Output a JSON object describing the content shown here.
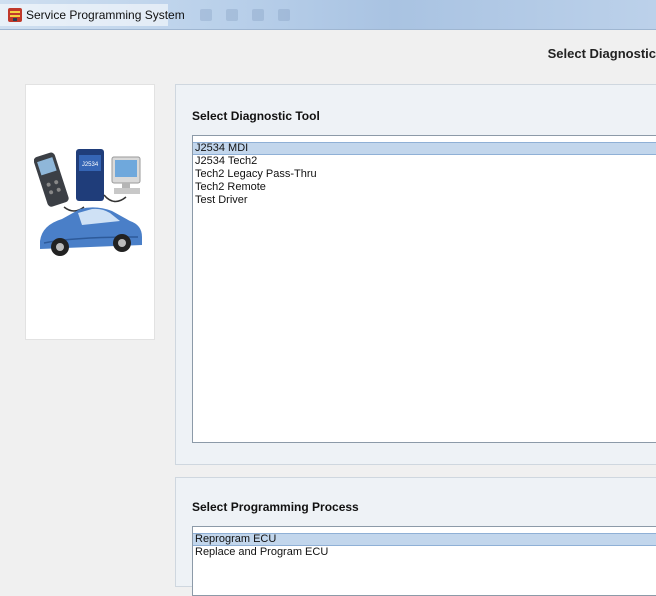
{
  "window": {
    "title": "Service Programming System"
  },
  "page": {
    "heading": "Select Diagnostic"
  },
  "illustration": {
    "label": "J2534"
  },
  "diagnostic_tool": {
    "title": "Select Diagnostic Tool",
    "items": [
      "J2534 MDI",
      "J2534 Tech2",
      "Tech2 Legacy Pass-Thru",
      "Tech2 Remote",
      "Test Driver"
    ],
    "selected": "J2534 MDI"
  },
  "programming_process": {
    "title": "Select Programming Process",
    "items": [
      "Reprogram ECU",
      "Replace and Program ECU"
    ],
    "selected": "Reprogram ECU"
  },
  "colors": {
    "selection": "#c2d6ec",
    "group_background": "#eef2f6",
    "titlebar": "#b9d0ea"
  }
}
